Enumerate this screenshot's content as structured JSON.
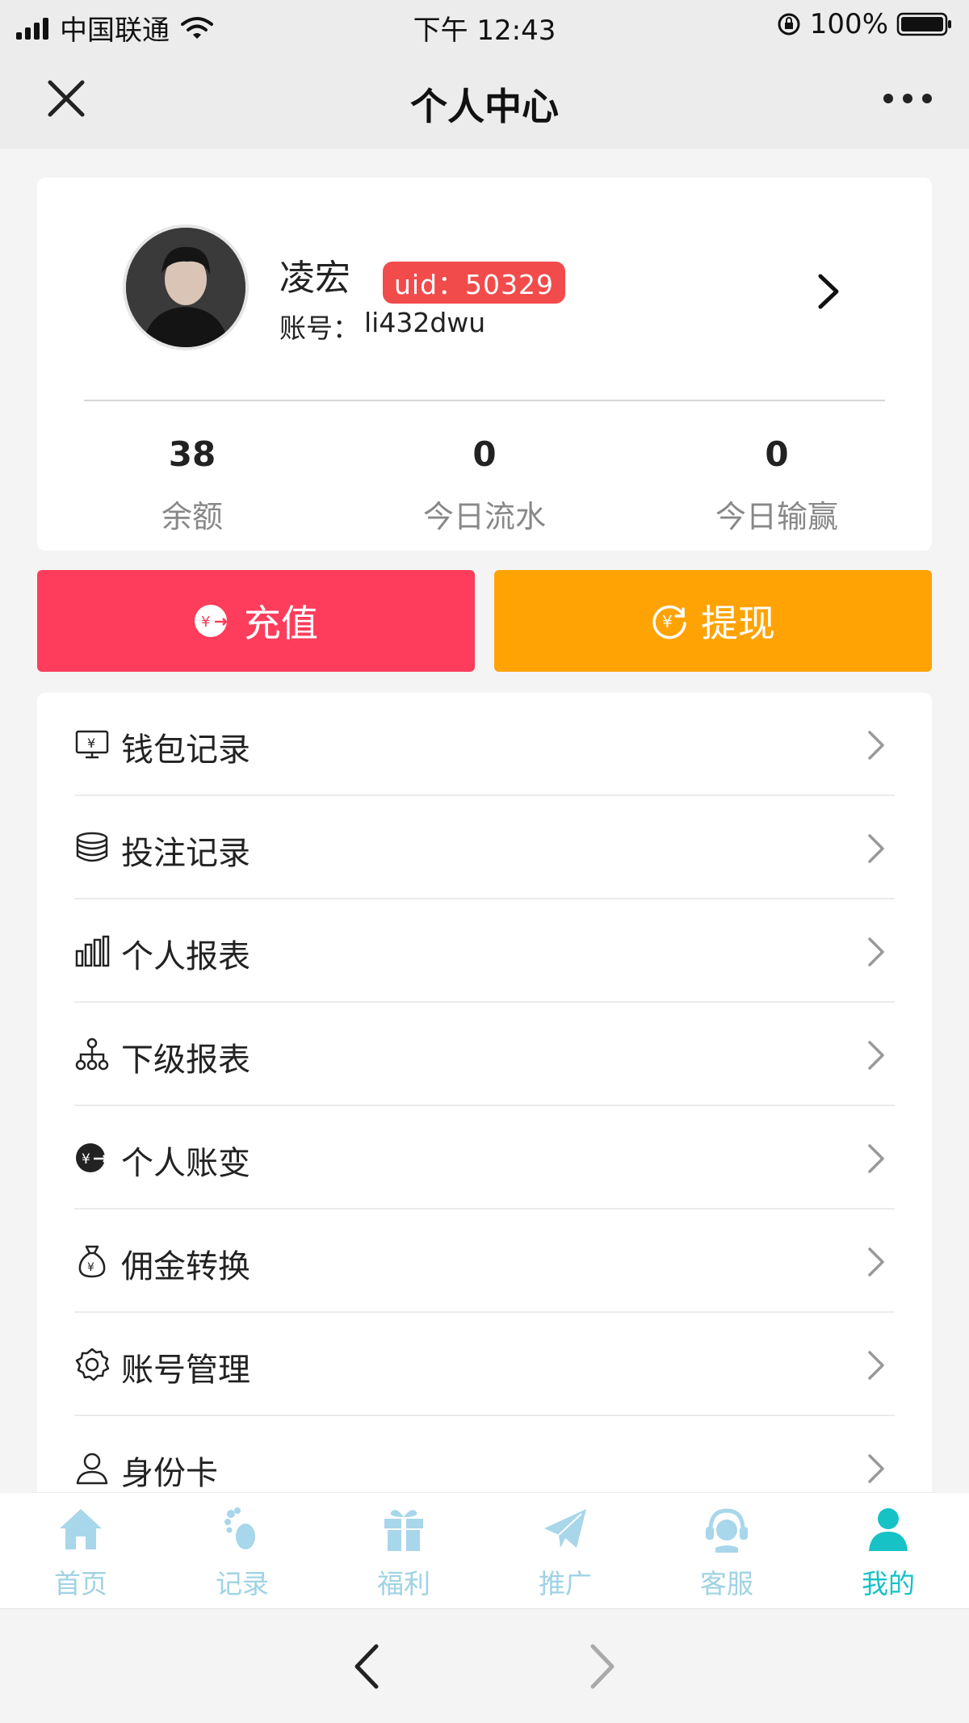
{
  "status_bar": {
    "carrier": "中国联通",
    "time": "下午 12:43",
    "battery": "100%"
  },
  "nav": {
    "title": "个人中心"
  },
  "profile": {
    "name": "凌宏",
    "uid_badge": "uid：50329",
    "account_label": "账号：",
    "account_value": "li432dwu"
  },
  "stats": [
    {
      "value": "38",
      "label": "余额"
    },
    {
      "value": "0",
      "label": "今日流水"
    },
    {
      "value": "0",
      "label": "今日输赢"
    }
  ],
  "actions": {
    "recharge": "充值",
    "withdraw": "提现"
  },
  "menu": [
    {
      "label": "钱包记录",
      "icon": "wallet-monitor-icon"
    },
    {
      "label": "投注记录",
      "icon": "coin-stack-icon"
    },
    {
      "label": "个人报表",
      "icon": "bar-chart-icon"
    },
    {
      "label": "下级报表",
      "icon": "hierarchy-icon"
    },
    {
      "label": "个人账变",
      "icon": "yen-coin-icon"
    },
    {
      "label": "佣金转换",
      "icon": "money-bag-icon"
    },
    {
      "label": "账号管理",
      "icon": "gear-icon"
    },
    {
      "label": "身份卡",
      "icon": "user-icon"
    }
  ],
  "tabs": [
    {
      "label": "首页",
      "icon": "home-icon"
    },
    {
      "label": "记录",
      "icon": "footprint-icon"
    },
    {
      "label": "福利",
      "icon": "gift-icon"
    },
    {
      "label": "推广",
      "icon": "paper-plane-icon"
    },
    {
      "label": "客服",
      "icon": "headset-icon"
    },
    {
      "label": "我的",
      "icon": "user-icon",
      "active": true
    }
  ],
  "colors": {
    "recharge": "#fd3d5b",
    "withdraw": "#ffa305",
    "uid_badge": "#f24b4b",
    "tab_inactive": "#9fd3e4",
    "tab_active": "#16c2c6"
  }
}
